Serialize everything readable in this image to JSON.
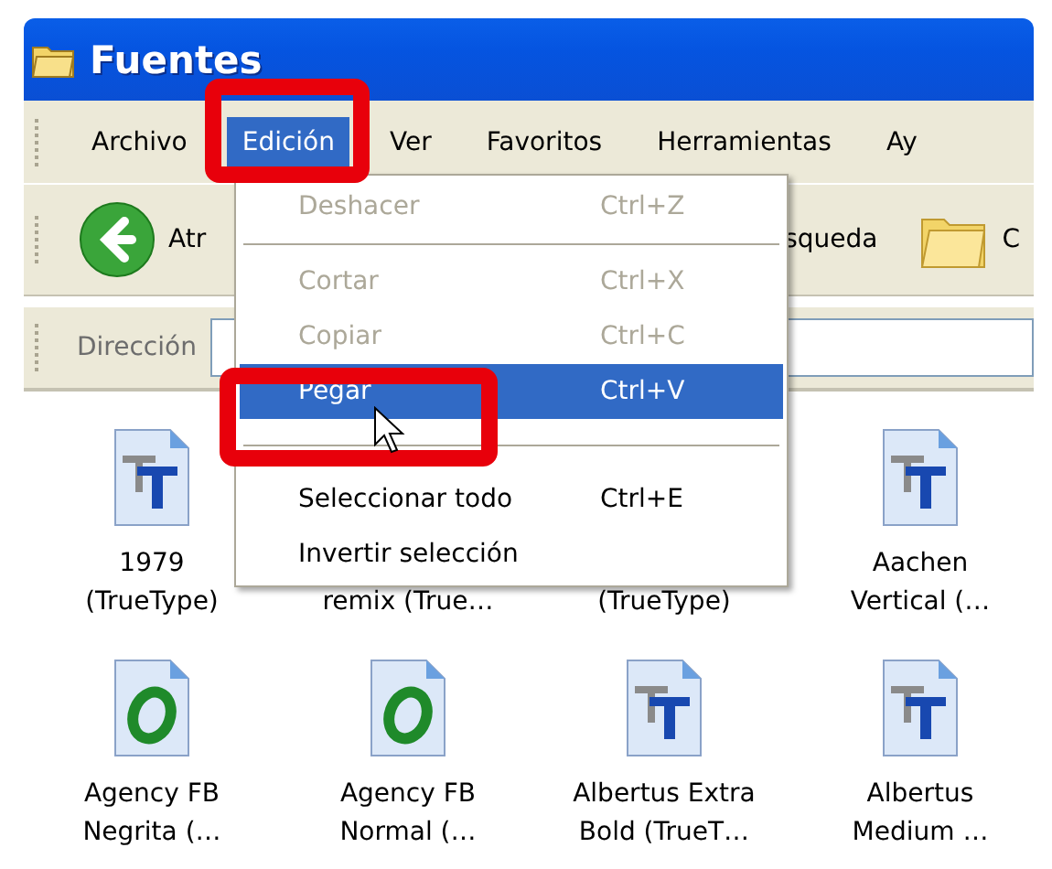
{
  "window": {
    "title": "Fuentes"
  },
  "menu_bar": [
    {
      "label": "Archivo",
      "selected": false
    },
    {
      "label": "Edición",
      "selected": true
    },
    {
      "label": "Ver",
      "selected": false
    },
    {
      "label": "Favoritos",
      "selected": false
    },
    {
      "label": "Herramientas",
      "selected": false
    },
    {
      "label": "Ay",
      "selected": false
    }
  ],
  "toolbar": {
    "back_label": "Atr",
    "search_label": "squeda",
    "folders_label": "C"
  },
  "address_bar": {
    "label": "Dirección"
  },
  "files": [
    {
      "kind": "truetype",
      "lines": [
        "1979",
        "(TrueType)"
      ]
    },
    {
      "kind": "covered",
      "lines": [
        "remix (True…"
      ]
    },
    {
      "kind": "covered",
      "lines": [
        "(TrueType)"
      ]
    },
    {
      "kind": "truetype",
      "lines": [
        "Aachen",
        "Vertical (…"
      ]
    },
    {
      "kind": "opentype",
      "lines": [
        "Agency FB",
        "Negrita (…"
      ]
    },
    {
      "kind": "opentype",
      "lines": [
        "Agency FB",
        "Normal (…"
      ]
    },
    {
      "kind": "truetype",
      "lines": [
        "Albertus Extra",
        "Bold (TrueT…"
      ]
    },
    {
      "kind": "truetype",
      "lines": [
        "Albertus",
        "Medium …"
      ]
    }
  ],
  "edit_menu": [
    {
      "kind": "item",
      "label": "Deshacer",
      "shortcut": "Ctrl+Z",
      "disabled": true,
      "selected": false
    },
    {
      "kind": "separator"
    },
    {
      "kind": "item",
      "label": "Cortar",
      "shortcut": "Ctrl+X",
      "disabled": true,
      "selected": false
    },
    {
      "kind": "item",
      "label": "Copiar",
      "shortcut": "Ctrl+C",
      "disabled": true,
      "selected": false
    },
    {
      "kind": "item",
      "label": "Pegar",
      "shortcut": "Ctrl+V",
      "disabled": false,
      "selected": true
    },
    {
      "kind": "separator"
    },
    {
      "kind": "item",
      "label": "Seleccionar todo",
      "shortcut": "Ctrl+E",
      "disabled": false,
      "selected": false
    },
    {
      "kind": "item",
      "label": "Invertir selección",
      "disabled": false,
      "selected": false
    }
  ]
}
